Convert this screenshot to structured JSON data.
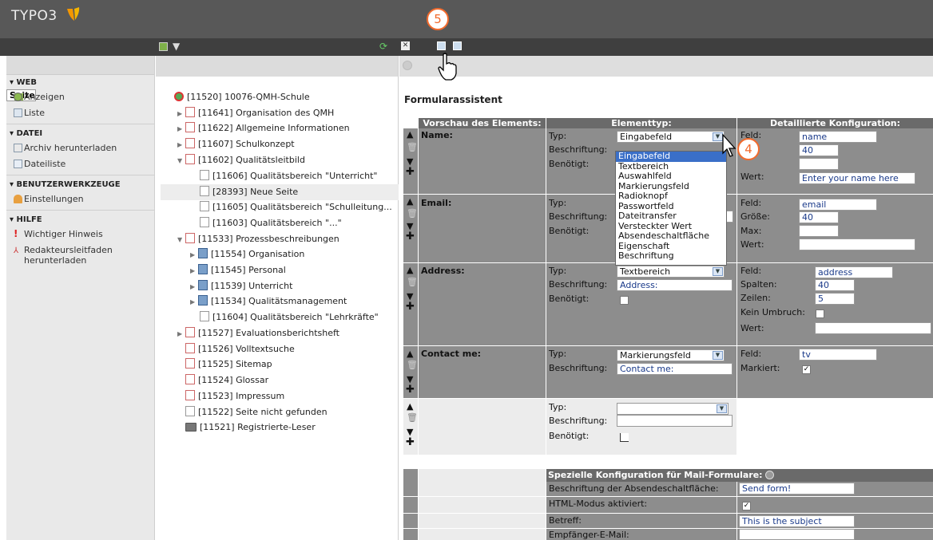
{
  "app": {
    "logo_text": "TYPO3"
  },
  "leftnav": {
    "sections": [
      {
        "title": "▾ WEB",
        "items": [
          "Seite",
          "Anzeigen",
          "Liste"
        ]
      },
      {
        "title": "▾ DATEI",
        "items": [
          "Archiv herunterladen",
          "Dateiliste"
        ]
      },
      {
        "title": "▾ BENUTZERWERKZEUGE",
        "items": [
          "Einstellungen"
        ]
      },
      {
        "title": "▾ HILFE",
        "items": [
          "Wichtiger Hinweis",
          "Redakteursleitfaden herunterladen"
        ]
      }
    ]
  },
  "tree": {
    "nodes": [
      "[11520] 10076-QMH-Schule",
      "[11641] Organisation des QMH",
      "[11622] Allgemeine Informationen",
      "[11607] Schulkonzept",
      "[11602] Qualitätsleitbild",
      "[11606] Qualitätsbereich \"Unterricht\"",
      "[28393] Neue Seite",
      "[11605] Qualitätsbereich \"Schulleitung...",
      "[11603] Qualitätsbereich \"...\"",
      "[11533] Prozessbeschreibungen",
      "[11554] Organisation",
      "[11545] Personal",
      "[11539] Unterricht",
      "[11534] Qualitätsmanagement",
      "[11604] Qualitätsbereich \"Lehrkräfte\"",
      "[11527] Evaluationsberichtsheft",
      "[11526] Volltextsuche",
      "[11525] Sitemap",
      "[11524] Glossar",
      "[11523] Impressum",
      "[11522] Seite nicht gefunden",
      "[11521] Registrierte-Leser"
    ]
  },
  "form": {
    "title": "Formularassistent",
    "headers": {
      "preview": "Vorschau des Elements:",
      "type": "Elementtyp:",
      "config": "Detaillierte Konfiguration:"
    },
    "labels": {
      "typ": "Typ:",
      "beschriftung": "Beschriftung:",
      "benoetigt": "Benötigt:",
      "feld": "Feld:",
      "groesse": "Größe:",
      "max": "Max:",
      "wert": "Wert:",
      "spalten": "Spalten:",
      "zeilen": "Zeilen:",
      "kein_umbruch": "Kein Umbruch:",
      "markiert": "Markiert:"
    },
    "row_name": {
      "preview": "Name:",
      "type": "Eingabefeld",
      "feld": "name",
      "groesse": "40",
      "wert": "Enter your name here"
    },
    "row_email": {
      "preview": "Email:",
      "feld": "email",
      "groesse": "40"
    },
    "row_address": {
      "preview": "Address:",
      "type": "Textbereich",
      "beschriftung": "Address:",
      "feld": "address",
      "spalten": "40",
      "zeilen": "5"
    },
    "row_contact": {
      "preview": "Contact me:",
      "type": "Markierungsfeld",
      "beschriftung": "Contact me:",
      "feld": "tv"
    },
    "dropdown_options": [
      "Eingabefeld",
      "Textbereich",
      "Auswahlfeld",
      "Markierungsfeld",
      "Radioknopf",
      "Passwortfeld",
      "Dateitransfer",
      "Versteckter Wert",
      "Absendeschaltfläche",
      "Eigenschaft",
      "Beschriftung"
    ],
    "mail": {
      "header": "Spezielle Konfiguration für Mail-Formulare:",
      "submit_label": "Beschriftung der Absendeschaltfläche:",
      "submit_value": "Send form!",
      "html_label": "HTML-Modus aktiviert:",
      "subject_label": "Betreff:",
      "subject_value": "This is the subject",
      "recipient_label": "Empfänger-E-Mail:"
    }
  },
  "callouts": {
    "step4": "4",
    "step5": "5"
  },
  "colors": {
    "accent": "#f26a2c",
    "highlight": "#3a6fc8"
  }
}
